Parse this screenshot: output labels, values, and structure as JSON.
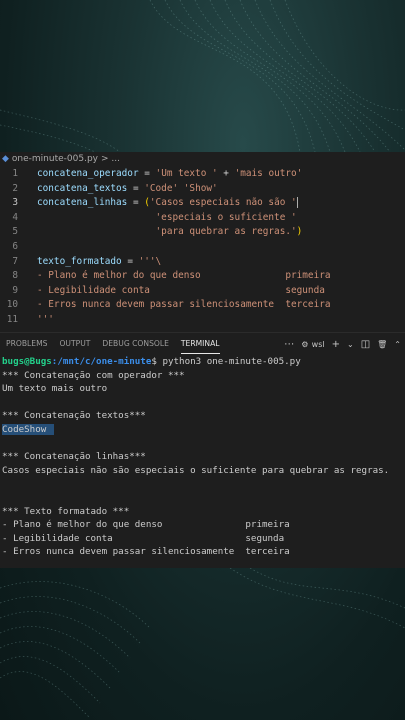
{
  "file": {
    "name": "one-minute-005.py",
    "suffix": "> ..."
  },
  "code": [
    {
      "ln": "1",
      "tokens": [
        [
          "var",
          "concatena_operador"
        ],
        [
          "op",
          " = "
        ],
        [
          "str",
          "'Um texto '"
        ],
        [
          "op",
          " + "
        ],
        [
          "str",
          "'mais outro'"
        ]
      ]
    },
    {
      "ln": "2",
      "tokens": [
        [
          "var",
          "concatena_textos"
        ],
        [
          "op",
          " = "
        ],
        [
          "str",
          "'Code'"
        ],
        [
          "op",
          " "
        ],
        [
          "str",
          "'Show'"
        ]
      ]
    },
    {
      "ln": "3",
      "active": true,
      "tokens": [
        [
          "var",
          "concatena_linhas"
        ],
        [
          "op",
          " = "
        ],
        [
          "br",
          "("
        ],
        [
          "str",
          "'Casos especiais não são '"
        ]
      ]
    },
    {
      "ln": "4",
      "tokens": [
        [
          "op",
          "                     "
        ],
        [
          "str",
          "'especiais o suficiente '"
        ]
      ]
    },
    {
      "ln": "5",
      "tokens": [
        [
          "op",
          "                     "
        ],
        [
          "str",
          "'para quebrar as regras.'"
        ],
        [
          "br",
          ")"
        ]
      ]
    },
    {
      "ln": "6",
      "tokens": []
    },
    {
      "ln": "7",
      "tokens": [
        [
          "var",
          "texto_formatado"
        ],
        [
          "op",
          " = "
        ],
        [
          "str",
          "'''\\"
        ]
      ]
    },
    {
      "ln": "8",
      "tokens": [
        [
          "str",
          "- Plano é melhor do que denso               primeira"
        ]
      ]
    },
    {
      "ln": "9",
      "tokens": [
        [
          "str",
          "- Legibilidade conta                        segunda"
        ]
      ]
    },
    {
      "ln": "10",
      "tokens": [
        [
          "str",
          "- Erros nunca devem passar silenciosamente  terceira"
        ]
      ]
    },
    {
      "ln": "11",
      "tokens": [
        [
          "str",
          "'''"
        ]
      ]
    }
  ],
  "panel": {
    "tabs": [
      "PROBLEMS",
      "OUTPUT",
      "DEBUG CONSOLE",
      "TERMINAL"
    ],
    "active_tab": "TERMINAL",
    "more": "⋯",
    "shell": "wsl",
    "add": "+",
    "dropdown": "⌄",
    "split": "◫",
    "trash": "🗑",
    "collapse": "⌃"
  },
  "terminal": {
    "prompt_user": "bugs@Bugs",
    "prompt_path": ":/mnt/c/one-minute",
    "prompt_cmd": "$ python3 one-minute-005.py",
    "lines": [
      "*** Concatenação com operador ***",
      "Um texto mais outro",
      "",
      "*** Concatenação textos***",
      "CodeShow",
      "",
      "*** Concatenação linhas***",
      "Casos especiais não são especiais o suficiente para quebrar as regras.",
      "",
      "",
      "*** Texto formatado ***",
      "- Plano é melhor do que denso               primeira",
      "- Legibilidade conta                        segunda",
      "- Erros nunca devem passar silenciosamente  terceira"
    ],
    "highlight_index": 4
  }
}
